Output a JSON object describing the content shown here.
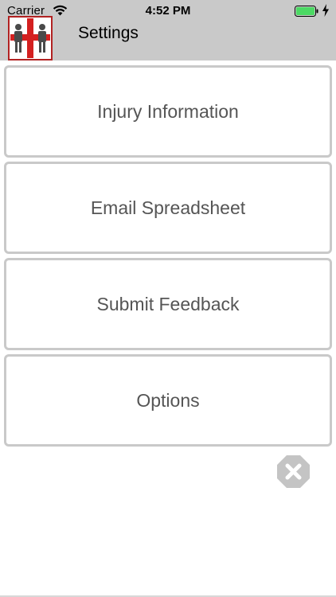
{
  "status_bar": {
    "carrier": "Carrier",
    "time": "4:52 PM",
    "battery_color": "#4cd964"
  },
  "nav": {
    "title": "Settings",
    "bar_color": "#c9c9c9",
    "logo_icon": "first-aid-people-logo"
  },
  "menu": {
    "items": [
      {
        "label": "Injury Information"
      },
      {
        "label": "Email Spreadsheet"
      },
      {
        "label": "Submit Feedback"
      },
      {
        "label": "Options"
      }
    ],
    "text_color": "#555555",
    "border_color": "#c9c9c9"
  },
  "close": {
    "icon": "close-octagon-icon",
    "color": "#c4c4c4"
  }
}
